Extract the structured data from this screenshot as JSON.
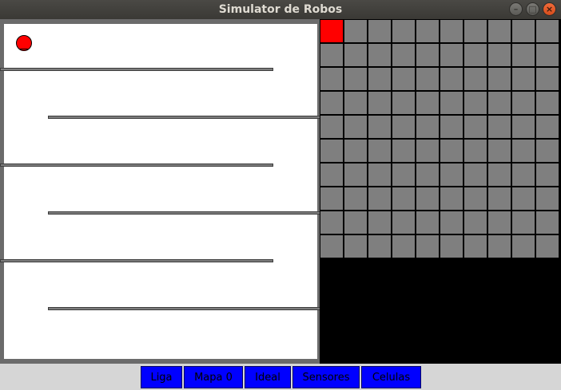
{
  "window": {
    "title": "Simulator de Robos"
  },
  "window_controls": {
    "minimize_icon": "minimize-icon",
    "maximize_icon": "maximize-icon",
    "close_icon": "close-icon"
  },
  "maze": {
    "background_color": "#ffffff",
    "wall_color": "#7d7d7d",
    "robot_color": "#ff0000"
  },
  "grid": {
    "rows": 10,
    "cols": 10,
    "cell_color": "#7f7f7f",
    "active_cell_color": "#ff0000",
    "active_cells": [
      [
        0,
        0
      ]
    ]
  },
  "toolbar": {
    "buttons": [
      {
        "label": "Liga"
      },
      {
        "label": "Mapa 0"
      },
      {
        "label": "Ideal"
      },
      {
        "label": "Sensores"
      },
      {
        "label": "Celulas"
      }
    ],
    "button_color": "#0000ff"
  }
}
